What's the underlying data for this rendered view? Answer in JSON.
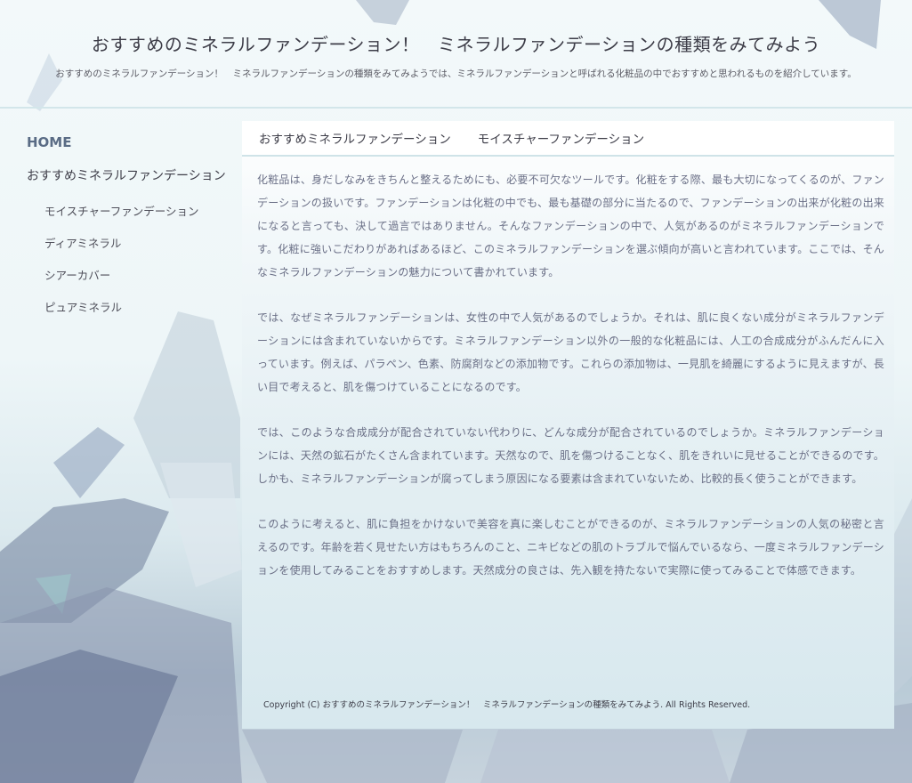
{
  "header": {
    "title": "おすすめのミネラルファンデーション！　ミネラルファンデーションの種類をみてみよう",
    "description": "おすすめのミネラルファンデーション！　ミネラルファンデーションの種類をみてみようでは、ミネラルファンデーションと呼ばれる化粧品の中でおすすめと思われるものを紹介しています。"
  },
  "sidebar": {
    "home": "HOME",
    "category": "おすすめミネラルファンデーション",
    "items": [
      {
        "label": "モイスチャーファンデーション"
      },
      {
        "label": "ディアミネラル"
      },
      {
        "label": "シアーカバー"
      },
      {
        "label": "ピュアミネラル"
      }
    ]
  },
  "content": {
    "breadcrumb": [
      "おすすめミネラルファンデーション",
      "モイスチャーファンデーション"
    ],
    "paragraphs": [
      "化粧品は、身だしなみをきちんと整えるためにも、必要不可欠なツールです。化粧をする際、最も大切になってくるのが、ファンデーションの扱いです。ファンデーションは化粧の中でも、最も基礎の部分に当たるので、ファンデーションの出来が化粧の出来になると言っても、決して過言ではありません。そんなファンデーションの中で、人気があるのがミネラルファンデーションです。化粧に強いこだわりがあればあるほど、このミネラルファンデーションを選ぶ傾向が高いと言われています。ここでは、そんなミネラルファンデーションの魅力について書かれています。",
      "では、なぜミネラルファンデーションは、女性の中で人気があるのでしょうか。それは、肌に良くない成分がミネラルファンデーションには含まれていないからです。ミネラルファンデーション以外の一般的な化粧品には、人工の合成成分がふんだんに入っています。例えば、パラペン、色素、防腐剤などの添加物です。これらの添加物は、一見肌を綺麗にするように見えますが、長い目で考えると、肌を傷つけていることになるのです。",
      "では、このような合成成分が配合されていない代わりに、どんな成分が配合されているのでしょうか。ミネラルファンデーションには、天然の鉱石がたくさん含まれています。天然なので、肌を傷つけることなく、肌をきれいに見せることができるのです。しかも、ミネラルファンデーションが腐ってしまう原因になる要素は含まれていないため、比較的長く使うことができます。",
      "このように考えると、肌に負担をかけないで美容を真に楽しむことができるのが、ミネラルファンデーションの人気の秘密と言えるのです。年齢を若く見せたい方はもちろんのこと、ニキビなどの肌のトラブルで悩んでいるなら、一度ミネラルファンデーションを使用してみることをおすすめします。天然成分の良さは、先入観を持たないで実際に使ってみることで体感できます。"
    ],
    "copyright": "Copyright (C)  おすすめのミネラルファンデーション！　ミネラルファンデーションの種類をみてみよう.  All Rights Reserved."
  }
}
